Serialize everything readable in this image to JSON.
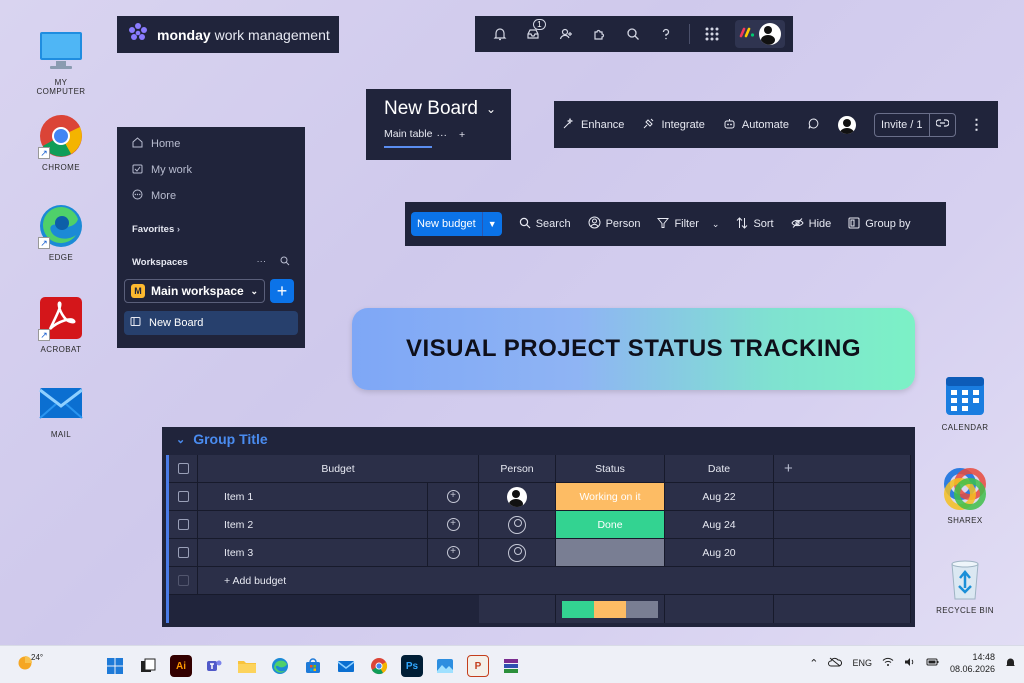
{
  "desktop": {
    "icons_left": [
      {
        "label": "MY COMPUTER",
        "icon": "monitor-icon"
      },
      {
        "label": "CHROME",
        "icon": "chrome-icon"
      },
      {
        "label": "EDGE",
        "icon": "edge-icon"
      },
      {
        "label": "ACROBAT",
        "icon": "acrobat-icon"
      },
      {
        "label": "MAIL",
        "icon": "mail-icon"
      }
    ],
    "icons_right": [
      {
        "label": "CALENDAR",
        "icon": "calendar-icon"
      },
      {
        "label": "SHAREX",
        "icon": "sharex-icon"
      },
      {
        "label": "RECYCLE BIN",
        "icon": "recycle-bin-icon"
      }
    ]
  },
  "logo": {
    "brand": "monday",
    "suffix": "work management"
  },
  "topbar": {
    "notification_badge": "1"
  },
  "leftnav": {
    "home": "Home",
    "my_work": "My work",
    "more": "More",
    "favorites": "Favorites",
    "workspaces": "Workspaces",
    "workspace_initial": "M",
    "workspace_name": "Main workspace",
    "board_item": "New Board"
  },
  "board": {
    "title": "New Board",
    "tab_main": "Main table",
    "tab_more": "···",
    "tab_add": "+"
  },
  "actions": {
    "enhance": "Enhance",
    "integrate": "Integrate",
    "automate": "Automate",
    "invite": "Invite / 1"
  },
  "toolbar": {
    "new_label": "New budget",
    "search": "Search",
    "person": "Person",
    "filter": "Filter",
    "sort": "Sort",
    "hide": "Hide",
    "group_by": "Group by"
  },
  "banner": {
    "text": "VISUAL PROJECT STATUS TRACKING"
  },
  "table": {
    "group_title": "Group Title",
    "headers": {
      "name": "Budget",
      "person": "Person",
      "status": "Status",
      "date": "Date",
      "add": "+"
    },
    "rows": [
      {
        "name": "Item 1",
        "status": "Working on it",
        "date": "Aug 22"
      },
      {
        "name": "Item 2",
        "status": "Done",
        "date": "Aug 24"
      },
      {
        "name": "Item 3",
        "status": "",
        "date": "Aug 20"
      }
    ],
    "add_item": "+ Add budget",
    "status_colors": {
      "working": "#fdbc64",
      "done": "#33d391",
      "empty": "#797e93"
    },
    "status_summary": [
      {
        "label": "Done",
        "share": 0.333,
        "color": "#33d391"
      },
      {
        "label": "Working on it",
        "share": 0.333,
        "color": "#fdbc64"
      },
      {
        "label": "",
        "share": 0.333,
        "color": "#797e93"
      }
    ]
  },
  "taskbar": {
    "weather_temp": "24°",
    "apps": [
      "start-icon",
      "task-view-icon",
      "illustrator-icon",
      "teams-icon",
      "file-explorer-icon",
      "edge-icon",
      "store-icon",
      "mail-icon",
      "chrome-icon",
      "photoshop-icon",
      "photos-icon",
      "powerpoint-icon",
      "winrar-icon"
    ],
    "language": "ENG",
    "time": "14:48",
    "date": "08.06.2026"
  },
  "colors": {
    "accent": "#0b73e8",
    "panel": "#20243b",
    "group": "#4a8cf0"
  }
}
